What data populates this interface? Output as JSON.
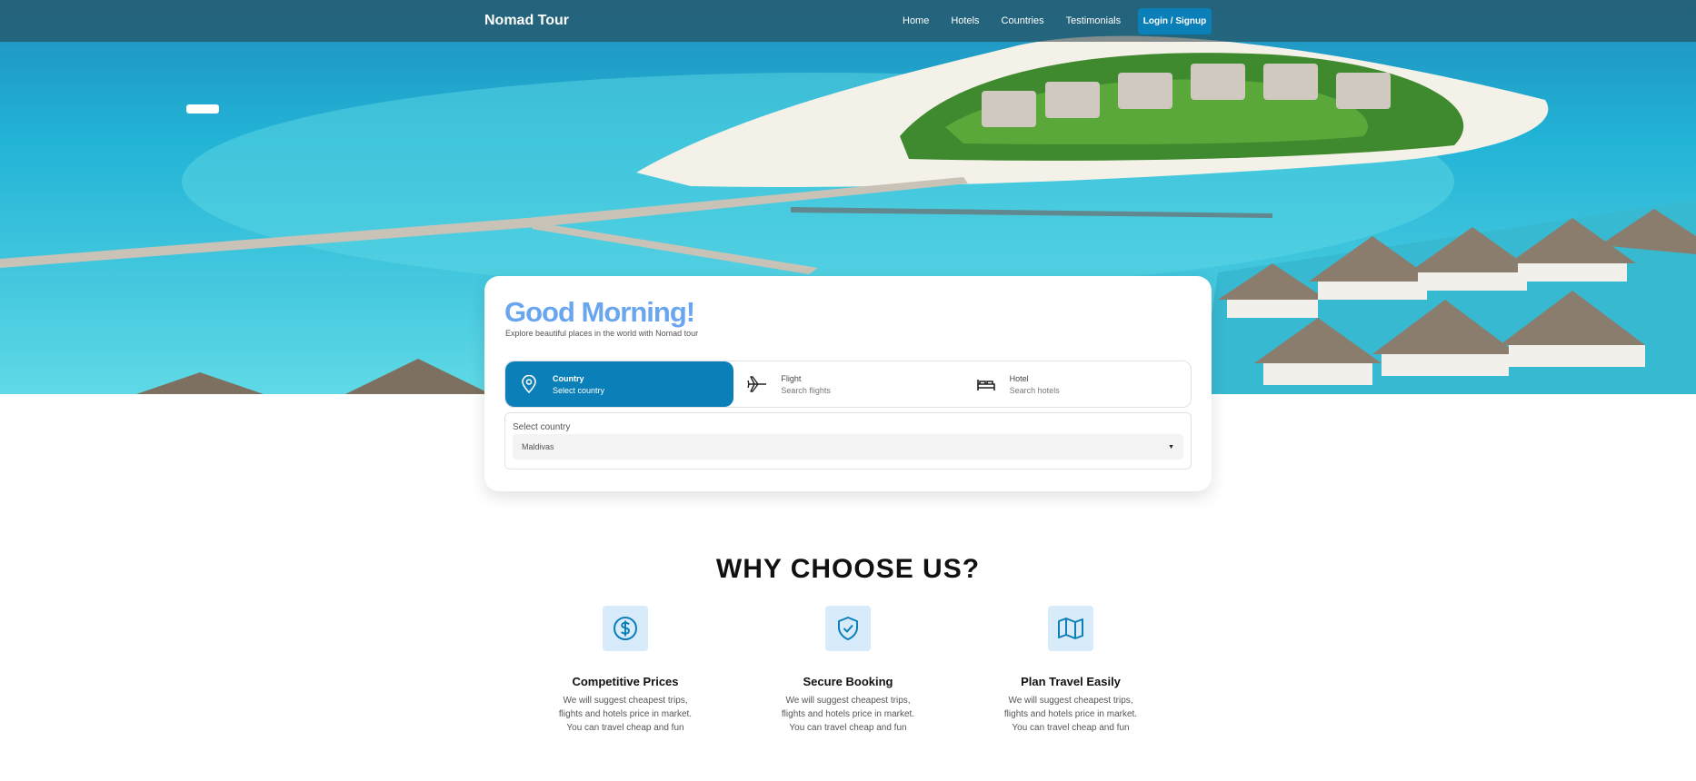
{
  "navbar": {
    "brand": "Nomad Tour",
    "links": [
      "Home",
      "Hotels",
      "Countries",
      "Testimonials"
    ],
    "login_label": "Login / Signup"
  },
  "search_card": {
    "greeting": "Good Morning!",
    "subtitle": "Explore beautiful places in the world with Nomad tour",
    "tabs": [
      {
        "title": "Country",
        "subtitle": "Select country",
        "icon": "map-pin-icon",
        "active": true
      },
      {
        "title": "Flight",
        "subtitle": "Search flights",
        "icon": "plane-icon",
        "active": false
      },
      {
        "title": "Hotel",
        "subtitle": "Search hotels",
        "icon": "bed-icon",
        "active": false
      }
    ],
    "select_label": "Select country",
    "selected_country": "Maldivas"
  },
  "why_section": {
    "title": "WHY CHOOSE US?",
    "features": [
      {
        "title": "Competitive Prices",
        "icon": "dollar-icon",
        "line1": "We will suggest cheapest trips,",
        "line2": "flights and hotels price in market.",
        "line3": "You can travel cheap and fun"
      },
      {
        "title": "Secure Booking",
        "icon": "shield-check-icon",
        "line1": "We will suggest cheapest trips,",
        "line2": "flights and hotels price in market.",
        "line3": "You can travel cheap and fun"
      },
      {
        "title": "Plan Travel Easily",
        "icon": "map-icon",
        "line1": "We will suggest cheapest trips,",
        "line2": "flights and hotels price in market.",
        "line3": "You can travel cheap and fun"
      }
    ]
  },
  "colors": {
    "primary": "#0b7fb8",
    "greeting": "#6aa6ef",
    "feature_icon_bg": "#d8ebfb"
  }
}
